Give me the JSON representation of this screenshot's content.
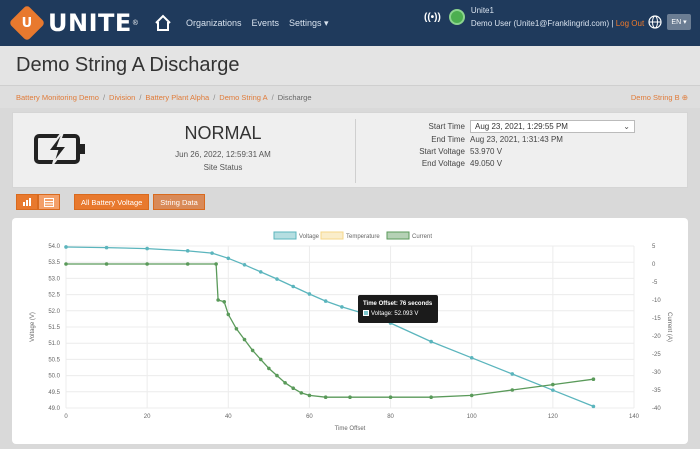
{
  "nav": {
    "logo_text": "UNITE",
    "logo_tm": "®",
    "links": [
      "Organizations",
      "Events",
      "Settings ▾"
    ],
    "user_name": "Unite1",
    "user_detail": "Demo User (Unite1@Franklingrid.com) | ",
    "logout_label": "Log Out",
    "lang_label": "EN ▾",
    "radio_label": "((•))"
  },
  "page": {
    "title": "Demo String A Discharge"
  },
  "breadcrumb": {
    "items": [
      "Battery Monitoring Demo",
      "Division",
      "Battery Plant Alpha",
      "Demo String A"
    ],
    "current": "Discharge",
    "right_link": "Demo String B ⊕"
  },
  "status": {
    "state": "NORMAL",
    "date": "Jun 26, 2022, 12:59:31 AM",
    "sub": "Site Status"
  },
  "info": {
    "start_time_label": "Start Time",
    "start_time_value": "Aug 23, 2021, 1:29:55 PM",
    "end_time_label": "End Time",
    "end_time_value": "Aug 23, 2021, 1:31:43 PM",
    "start_voltage_label": "Start Voltage",
    "start_voltage_value": "53.970 V",
    "end_voltage_label": "End Voltage",
    "end_voltage_value": "49.050 V"
  },
  "toolbar": {
    "all_battery_voltage": "All Battery Voltage",
    "string_data": "String Data"
  },
  "tooltip": {
    "title": "Time Offset: 76 seconds",
    "value": "Voltage: 52.093 V"
  },
  "colors": {
    "accent": "#e8792e",
    "voltage": "#5bb5bd",
    "temperature": "#f5d78a",
    "current": "#5a9a5a"
  },
  "chart_data": {
    "type": "line",
    "xlabel": "Time Offset",
    "ylabel": "Voltage (V)",
    "y2label": "Current (A)",
    "xlim": [
      0,
      140
    ],
    "ylim": [
      49.0,
      54.0
    ],
    "y2lim": [
      -40,
      5
    ],
    "x_ticks": [
      0,
      20,
      40,
      60,
      80,
      100,
      120,
      140
    ],
    "y_ticks": [
      49.0,
      49.5,
      50.0,
      50.5,
      51.0,
      51.5,
      52.0,
      52.5,
      53.0,
      53.5,
      54.0
    ],
    "y2_ticks": [
      5,
      0,
      -5,
      -10,
      -15,
      -20,
      -25,
      -30,
      -35,
      -40
    ],
    "legend": [
      "Voltage",
      "Temperature",
      "Current"
    ],
    "series": [
      {
        "name": "Voltage",
        "axis": "left",
        "x": [
          0,
          10,
          20,
          30,
          36,
          40,
          44,
          48,
          52,
          56,
          60,
          64,
          68,
          72,
          76,
          80,
          90,
          100,
          110,
          120,
          130
        ],
        "values": [
          53.97,
          53.95,
          53.92,
          53.85,
          53.78,
          53.62,
          53.42,
          53.2,
          52.98,
          52.75,
          52.52,
          52.3,
          52.12,
          51.97,
          51.82,
          51.62,
          51.05,
          50.55,
          50.05,
          49.55,
          49.05
        ]
      },
      {
        "name": "Current",
        "axis": "right",
        "x": [
          0,
          10,
          20,
          30,
          37,
          37.5,
          39,
          40,
          42,
          44,
          46,
          48,
          50,
          52,
          54,
          56,
          58,
          60,
          64,
          70,
          80,
          90,
          100,
          110,
          120,
          130
        ],
        "values": [
          0,
          0,
          0,
          0,
          0,
          -10,
          -10.5,
          -14,
          -18,
          -21,
          -24,
          -26.5,
          -29,
          -31,
          -33,
          -34.5,
          -35.8,
          -36.5,
          -37,
          -37,
          -37,
          -37,
          -36.5,
          -35,
          -33.5,
          -32
        ]
      }
    ]
  }
}
